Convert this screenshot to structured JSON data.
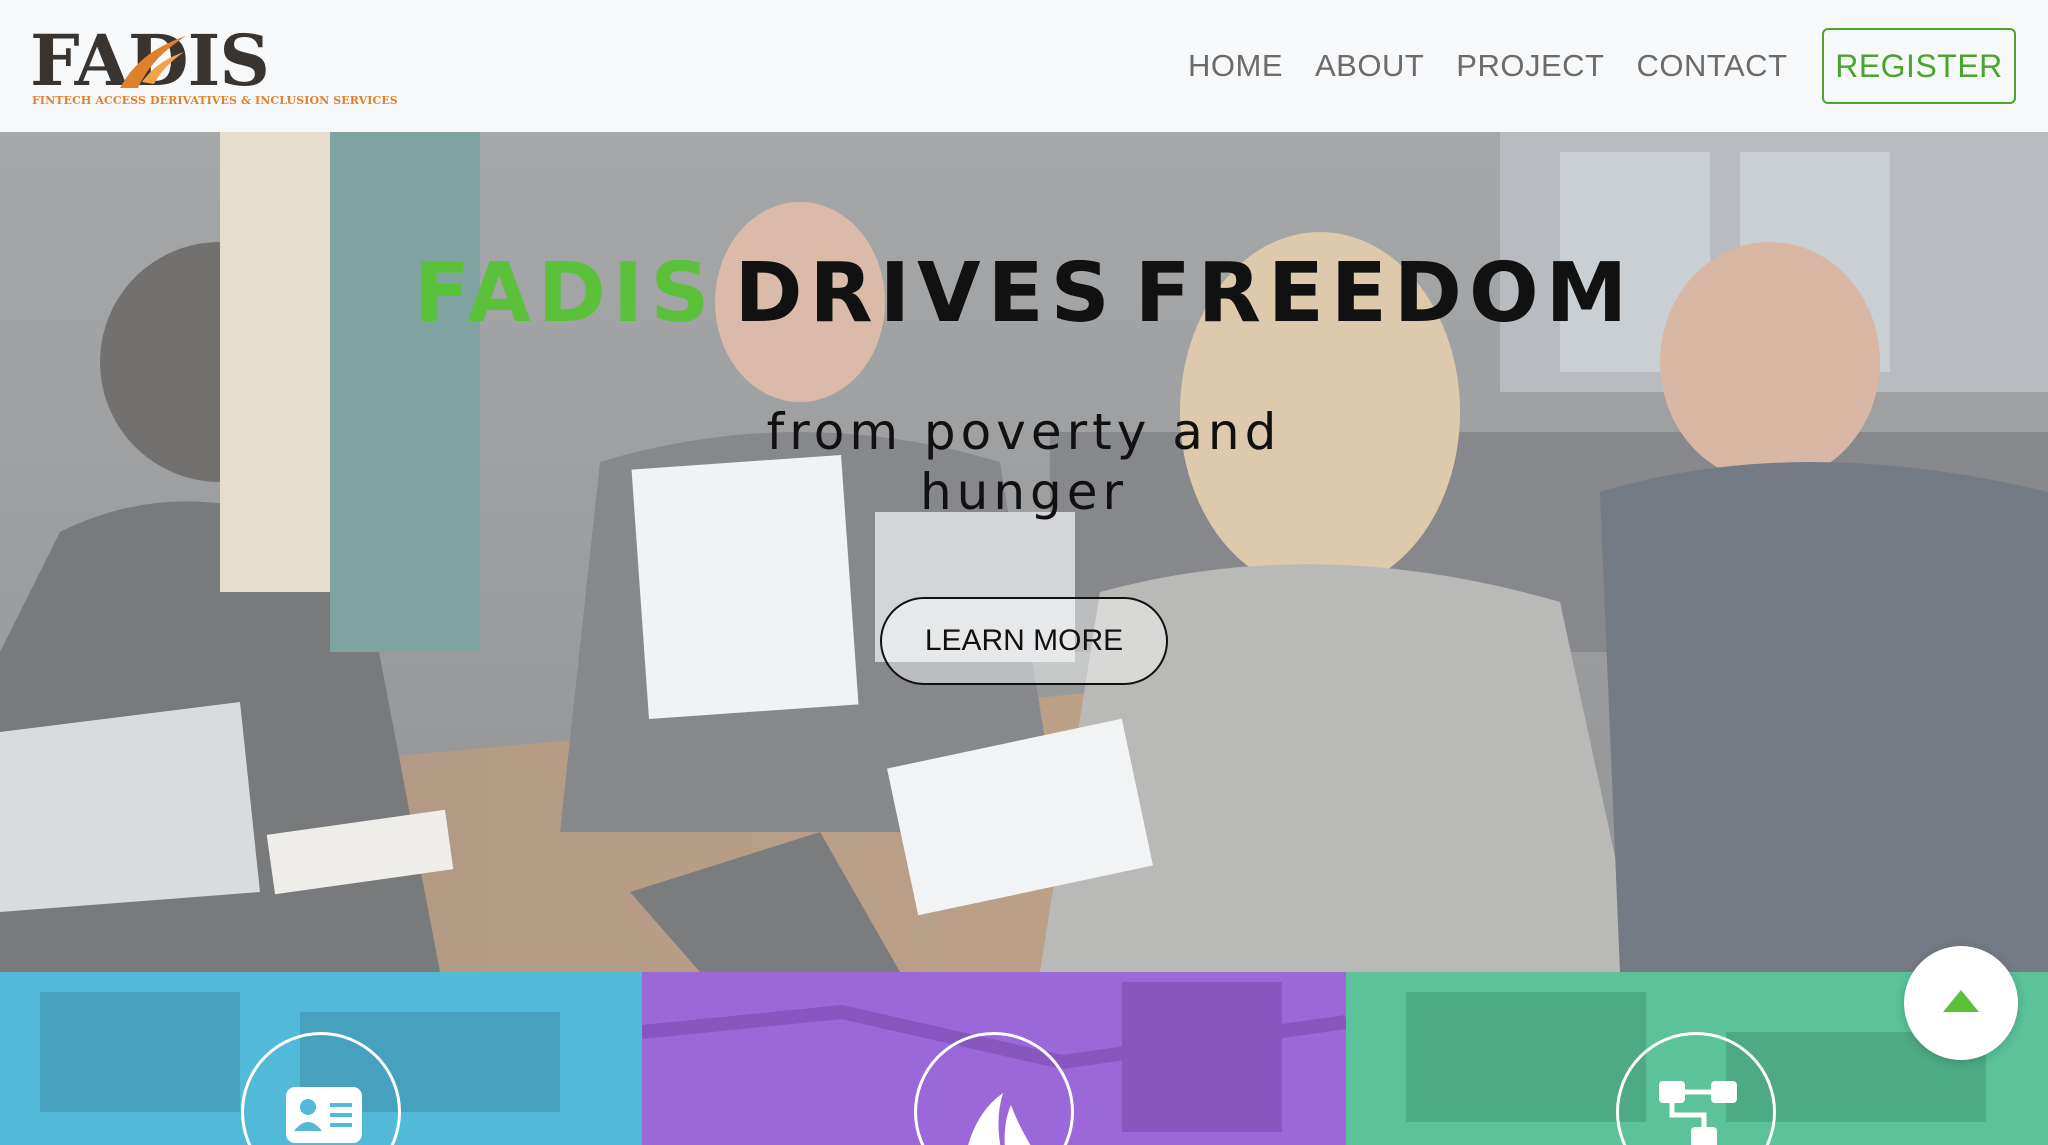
{
  "brand": {
    "logo_word": "FADIS",
    "logo_tagline": "FINTECH ACCESS DERIVATIVES & INCLUSION SERVICES",
    "colors": {
      "green": "#5cc13a",
      "orange": "#e0802a",
      "dark": "#3a3430"
    }
  },
  "nav": {
    "items": [
      {
        "label": "HOME"
      },
      {
        "label": "ABOUT"
      },
      {
        "label": "PROJECT"
      },
      {
        "label": "CONTACT"
      }
    ],
    "register_label": "REGISTER"
  },
  "hero": {
    "title_brand": "FADIS",
    "title_word_1": "DRIVES",
    "title_word_2": "FREEDOM",
    "subtitle": "from  poverty  and hunger",
    "cta_label": "LEARN MORE"
  },
  "tiles": [
    {
      "icon": "id-card-icon",
      "color": "#52b9d9"
    },
    {
      "icon": "sail-icon",
      "color": "#9b68d9"
    },
    {
      "icon": "sitemap-icon",
      "color": "#5bc29a"
    }
  ],
  "scroll_top": {
    "icon": "caret-up-icon",
    "color": "#5cc13a"
  }
}
